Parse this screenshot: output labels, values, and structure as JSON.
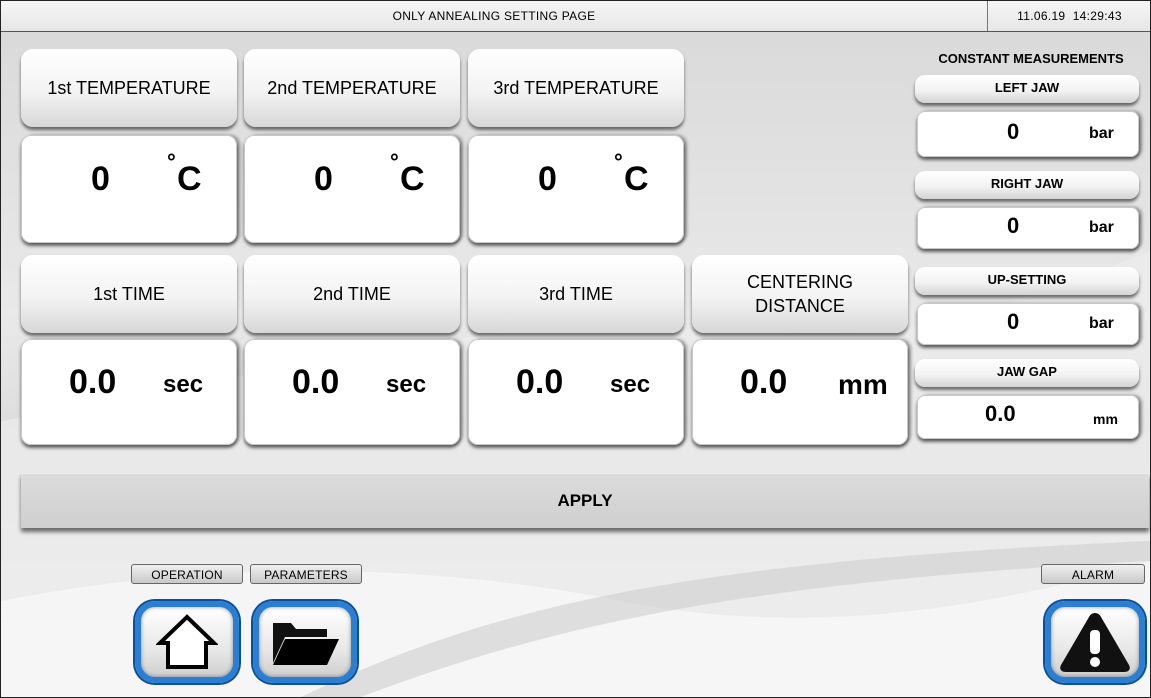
{
  "header": {
    "title": "ONLY ANNEALING SETTING PAGE",
    "date": "11.06.19",
    "time": "14:29:43"
  },
  "temperatures": [
    {
      "label": "1st TEMPERATURE",
      "value": "0",
      "unit": "C",
      "degree": "°"
    },
    {
      "label": "2nd TEMPERATURE",
      "value": "0",
      "unit": "C",
      "degree": "°"
    },
    {
      "label": "3rd TEMPERATURE",
      "value": "0",
      "unit": "C",
      "degree": "°"
    }
  ],
  "times": [
    {
      "label": "1st TIME",
      "value": "0.0",
      "unit": "sec"
    },
    {
      "label": "2nd TIME",
      "value": "0.0",
      "unit": "sec"
    },
    {
      "label": "3rd TIME",
      "value": "0.0",
      "unit": "sec"
    }
  ],
  "centering": {
    "label_line1": "CENTERING",
    "label_line2": "DISTANCE",
    "value": "0.0",
    "unit": "mm"
  },
  "constant_measurements": {
    "title": "CONSTANT MEASUREMENTS",
    "items": [
      {
        "label": "LEFT JAW",
        "value": "0",
        "unit": "bar"
      },
      {
        "label": "RIGHT JAW",
        "value": "0",
        "unit": "bar"
      },
      {
        "label": "UP-SETTING",
        "value": "0",
        "unit": "bar"
      },
      {
        "label": "JAW GAP",
        "value": "0.0",
        "unit": "mm"
      }
    ]
  },
  "apply": {
    "label": "APPLY"
  },
  "nav": {
    "operation_label": "OPERATION",
    "operation_icon": "home-icon",
    "parameters_label": "PARAMETERS",
    "parameters_icon": "folder-open-icon",
    "alarm_label": "ALARM",
    "alarm_icon": "warning-icon"
  },
  "colors": {
    "nav_ring": "#2b7fd3",
    "background": "#e2e2e2"
  }
}
